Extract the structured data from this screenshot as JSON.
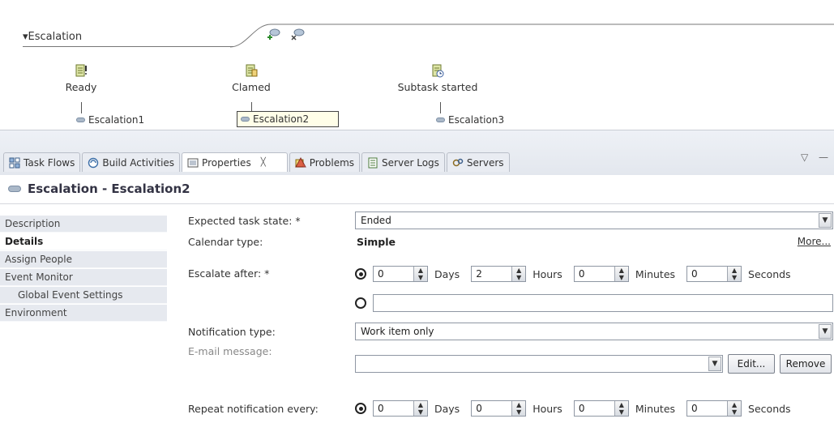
{
  "diagram": {
    "title": "▾Escalation",
    "states": [
      {
        "label": "Ready",
        "escalation": "Escalation1"
      },
      {
        "label": "Clamed",
        "escalation": "Escalation2"
      },
      {
        "label": "Subtask started",
        "escalation": "Escalation3"
      }
    ]
  },
  "tabs": [
    {
      "label": "Task Flows",
      "icon": "task-flows-icon"
    },
    {
      "label": "Build Activities",
      "icon": "build-activities-icon"
    },
    {
      "label": "Properties",
      "icon": "properties-icon",
      "close": "╳",
      "active": true
    },
    {
      "label": "Problems",
      "icon": "problems-icon"
    },
    {
      "label": "Server Logs",
      "icon": "server-logs-icon"
    },
    {
      "label": "Servers",
      "icon": "servers-icon"
    }
  ],
  "view_controls": {
    "minimize": "▽",
    "maximize": "—"
  },
  "properties": {
    "title": "Escalation - Escalation2"
  },
  "sidenav": {
    "items": [
      {
        "label": "Description"
      },
      {
        "label": "Details",
        "active": true
      },
      {
        "label": "Assign People"
      },
      {
        "label": "Event Monitor"
      },
      {
        "label": "Global Event Settings",
        "sub": true
      },
      {
        "label": "Environment"
      }
    ]
  },
  "form": {
    "expected_state": {
      "label": "Expected task state: *",
      "value": "Ended"
    },
    "calendar": {
      "label": "Calendar type:",
      "value": "Simple",
      "more": "More..."
    },
    "escalate_after": {
      "label": "Escalate after: *",
      "days": "0",
      "days_label": "Days",
      "hours": "2",
      "hours_label": "Hours",
      "minutes": "0",
      "minutes_label": "Minutes",
      "seconds": "0",
      "seconds_label": "Seconds"
    },
    "notification_type": {
      "label": "Notification type:",
      "value": "Work item only"
    },
    "email_message": {
      "label": "E-mail message:",
      "edit": "Edit...",
      "remove": "Remove"
    },
    "repeat": {
      "label": "Repeat notification every:",
      "days": "0",
      "days_label": "Days",
      "hours": "0",
      "hours_label": "Hours",
      "minutes": "0",
      "minutes_label": "Minutes",
      "seconds": "0",
      "seconds_label": "Seconds"
    }
  }
}
